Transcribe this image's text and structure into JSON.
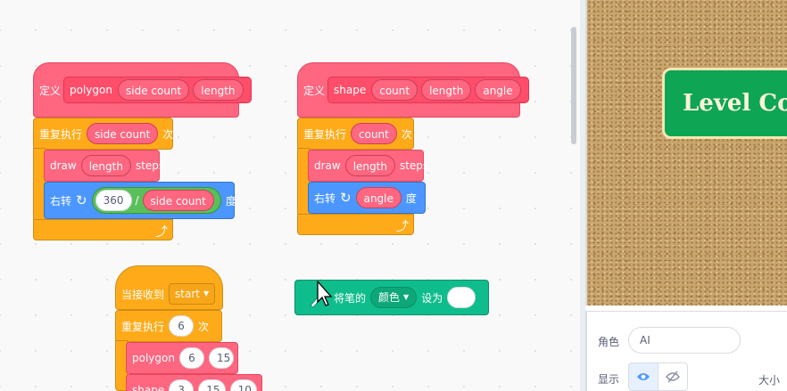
{
  "blocks": {
    "define1": {
      "define": "定义",
      "name": "polygon",
      "args": [
        "side count",
        "length"
      ]
    },
    "repeat1": {
      "label": "重复执行",
      "arg": "side count",
      "suffix": "次"
    },
    "draw1": {
      "label": "draw",
      "arg": "length",
      "suffix": "steps"
    },
    "turn1": {
      "label": "右转",
      "value": "360",
      "op": "/",
      "arg": "side count",
      "suffix": "度"
    },
    "define2": {
      "define": "定义",
      "name": "shape",
      "args": [
        "count",
        "length",
        "angle"
      ]
    },
    "repeat2": {
      "label": "重复执行",
      "arg": "count",
      "suffix": "次"
    },
    "draw2": {
      "label": "draw",
      "arg": "length",
      "suffix": "steps"
    },
    "turn2": {
      "label": "右转",
      "arg": "angle",
      "suffix": "度"
    },
    "event": {
      "label": "当接收到",
      "message": "start"
    },
    "repeat3": {
      "label": "重复执行",
      "count": "6",
      "suffix": "次"
    },
    "polygon_call": {
      "label": "polygon",
      "args": [
        "6",
        "15"
      ]
    },
    "shape_call": {
      "label": "shape",
      "args": [
        "3",
        "15",
        "10"
      ]
    },
    "pen": {
      "label": "将笔的",
      "param": "颜色",
      "set_to": "设为",
      "value": ""
    }
  },
  "stage": {
    "banner_text": "Level Co"
  },
  "sprite": {
    "name_label": "角色",
    "name_value": "AI",
    "show_label": "显示",
    "size_label": "大小"
  },
  "colors": {
    "custom_block": "#ff6680",
    "control": "#ffab19",
    "motion": "#4c97ff",
    "operator": "#59c059",
    "pen": "#0fbd8c"
  },
  "icons": [
    "turn-right-icon",
    "loop-arrow-icon",
    "pen-icon",
    "eye-icon",
    "eye-slash-icon",
    "dropdown-arrow-icon",
    "mouse-cursor-icon"
  ]
}
